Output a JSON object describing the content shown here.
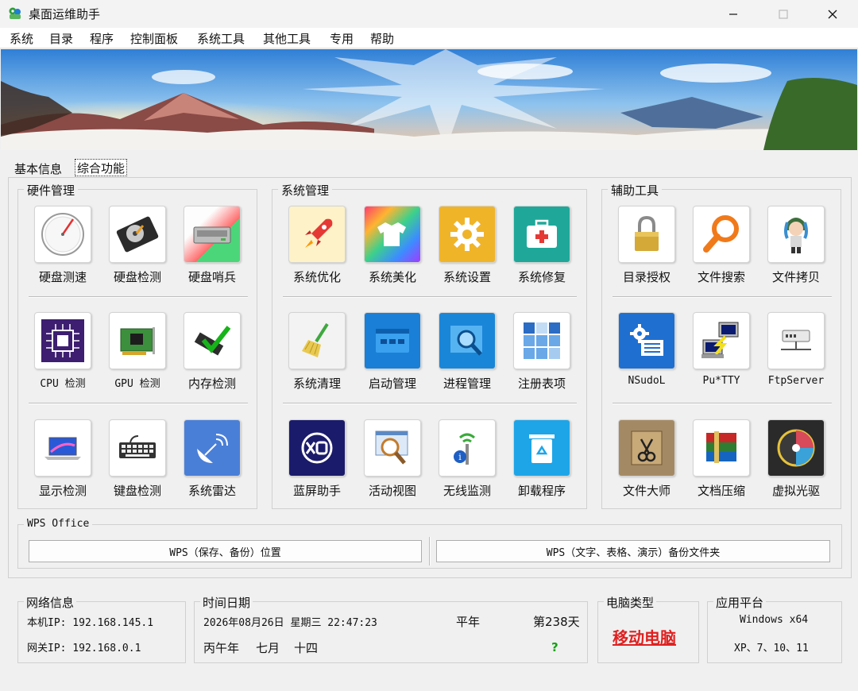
{
  "window": {
    "title": "桌面运维助手"
  },
  "menu": [
    "系统",
    "目录",
    "程序",
    "控制面板",
    "系统工具",
    "其他工具",
    "专用",
    "帮助"
  ],
  "tabs": [
    "基本信息",
    "综合功能"
  ],
  "groups": {
    "hardware": {
      "title": "硬件管理",
      "items": [
        "硬盘测速",
        "硬盘检测",
        "硬盘哨兵",
        "CPU 检测",
        "GPU 检测",
        "内存检测",
        "显示检测",
        "键盘检测",
        "系统雷达"
      ]
    },
    "system": {
      "title": "系统管理",
      "items": [
        "系统优化",
        "系统美化",
        "系统设置",
        "系统修复",
        "系统清理",
        "启动管理",
        "进程管理",
        "注册表项",
        "蓝屏助手",
        "活动视图",
        "无线监测",
        "卸载程序"
      ]
    },
    "aux": {
      "title": "辅助工具",
      "items": [
        "目录授权",
        "文件搜索",
        "文件拷贝",
        "NSudoL",
        "Pu*TTY",
        "FtpServer",
        "文件大师",
        "文档压缩",
        "虚拟光驱"
      ]
    }
  },
  "wps": {
    "title": "WPS Office",
    "btn_location": "WPS（保存、备份）位置",
    "btn_backup": "WPS（文字、表格、演示）备份文件夹"
  },
  "network": {
    "title": "网络信息",
    "local_ip": "本机IP: 192.168.145.1",
    "gateway_ip": "网关IP: 192.168.0.1"
  },
  "datetime": {
    "title": "时间日期",
    "date": "2026年08月26日 星期三 22:47:23",
    "year_type": "平年",
    "day_of_year": "第238天",
    "lunar_year": "丙午年",
    "lunar_month": "七月",
    "lunar_day": "十四",
    "extra": "?"
  },
  "computer": {
    "title": "电脑类型",
    "type": "移动电脑"
  },
  "platform": {
    "title": "应用平台",
    "line1": "Windows x64",
    "line2": "XP、7、10、11"
  },
  "colors": {
    "accent_red": "#e02020",
    "accent_green": "#13a313"
  }
}
